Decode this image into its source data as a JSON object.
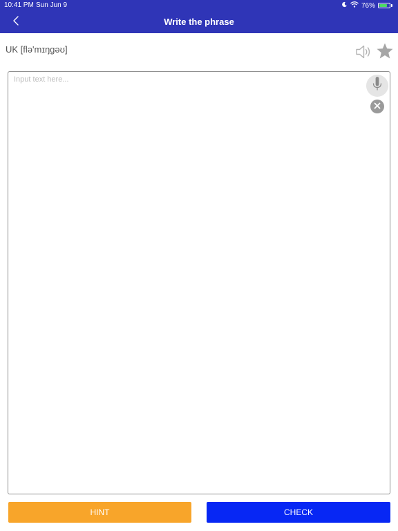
{
  "status_bar": {
    "time": "10:41 PM",
    "date": "Sun Jun 9",
    "battery_percent": "76%",
    "battery_level": 0.76,
    "icons": [
      "do-not-disturb-icon",
      "wifi-icon",
      "battery-charging-icon"
    ]
  },
  "header": {
    "title": "Write the phrase",
    "back_icon": "chevron-left-icon",
    "background_color": "#2f35b7"
  },
  "phrase": {
    "phonetic": "UK [flə'mɪŋgəʊ]",
    "speaker_icon": "speaker-icon",
    "favorite_icon": "star-icon"
  },
  "input": {
    "value": "",
    "placeholder": "Input text here...",
    "mic_icon": "microphone-icon",
    "clear_icon": "close-circle-icon"
  },
  "buttons": {
    "hint_label": "HINT",
    "check_label": "CHECK",
    "hint_color": "#f8a52a",
    "check_color": "#0727f4"
  }
}
